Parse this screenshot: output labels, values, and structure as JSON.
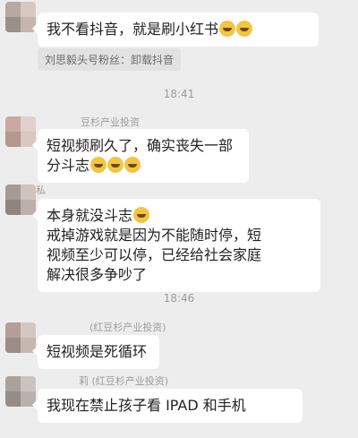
{
  "messages": [
    {
      "sender": "",
      "text": "我不看抖音，就是刷小红书",
      "emoji_count": 2,
      "emoji": "laughing-crying-emoji",
      "quote": "刘思毅头号粉丝：卸载抖音"
    },
    {
      "sender": "豆杉产业投资",
      "text": "短视频刷久了，确实丧失一部分斗志",
      "emoji_count": 3,
      "emoji": "flushed-emoji"
    },
    {
      "sender": "私",
      "text_lines": [
        "本身就没斗志",
        "戒掉游戏就是因为不能随时停，短",
        "视频至少可以停，已经给社会家庭",
        "解决很多争吵了"
      ],
      "emoji_count": 1,
      "emoji": "laughing-crying-emoji"
    },
    {
      "sender": "(红豆杉产业投资)",
      "text": "短视频是死循环"
    },
    {
      "sender": "莉 (红豆杉产业投资)",
      "text": "我现在禁止孩子看 IPAD 和手机"
    }
  ],
  "timestamps": {
    "first": "18:41",
    "second": "18:46"
  },
  "colors": {
    "background": "#ededed",
    "bubble": "#ffffff",
    "quote_bg": "#e2e2e2",
    "meta_text": "#9c9c9c"
  }
}
